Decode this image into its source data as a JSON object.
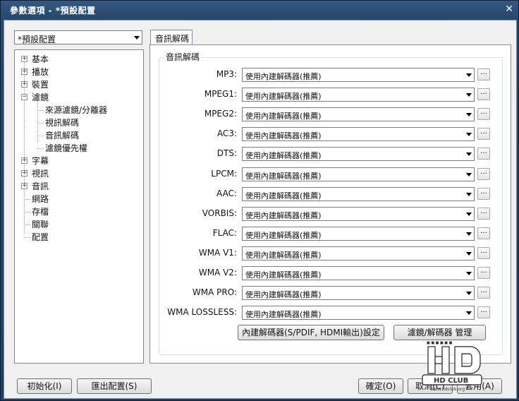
{
  "window": {
    "title": "參數選項 - *預設配置",
    "close_glyph": "✕"
  },
  "profile": {
    "selected": "*預設配置"
  },
  "tree": {
    "items": [
      {
        "label": "基本",
        "expander": "+",
        "level": 0
      },
      {
        "label": "播放",
        "expander": "+",
        "level": 0
      },
      {
        "label": "裝置",
        "expander": "+",
        "level": 0
      },
      {
        "label": "濾鏡",
        "expander": "−",
        "level": 0
      },
      {
        "label": "來源濾鏡/分離器",
        "level": 1
      },
      {
        "label": "視訊解碼",
        "level": 1
      },
      {
        "label": "音訊解碼",
        "level": 1
      },
      {
        "label": "濾鏡優先權",
        "level": 1
      },
      {
        "label": "字幕",
        "expander": "+",
        "level": 0
      },
      {
        "label": "視訊",
        "expander": "+",
        "level": 0
      },
      {
        "label": "音訊",
        "expander": "+",
        "level": 0
      },
      {
        "label": "網路",
        "level": 0
      },
      {
        "label": "存檔",
        "level": 0
      },
      {
        "label": "關聯",
        "level": 0
      },
      {
        "label": "配置",
        "level": 0
      }
    ]
  },
  "tab": {
    "label": "音訊解碼"
  },
  "group": {
    "label": "音訊解碼"
  },
  "decoders": [
    {
      "label": "MP3:",
      "value": "使用內建解碼器(推薦)"
    },
    {
      "label": "MPEG1:",
      "value": "使用內建解碼器(推薦)"
    },
    {
      "label": "MPEG2:",
      "value": "使用內建解碼器(推薦)"
    },
    {
      "label": "AC3:",
      "value": "使用內建解碼器(推薦)"
    },
    {
      "label": "DTS:",
      "value": "使用內建解碼器(推薦)"
    },
    {
      "label": "LPCM:",
      "value": "使用內建解碼器(推薦)"
    },
    {
      "label": "AAC:",
      "value": "使用內建解碼器(推薦)"
    },
    {
      "label": "VORBIS:",
      "value": "使用內建解碼器(推薦)"
    },
    {
      "label": "FLAC:",
      "value": "使用內建解碼器(推薦)"
    },
    {
      "label": "WMA V1:",
      "value": "使用內建解碼器(推薦)"
    },
    {
      "label": "WMA V2:",
      "value": "使用內建解碼器(推薦)"
    },
    {
      "label": "WMA PRO:",
      "value": "使用內建解碼器(推薦)"
    },
    {
      "label": "WMA LOSSLESS:",
      "value": "使用內建解碼器(推薦)"
    }
  ],
  "dots_label": "...",
  "panel_buttons": {
    "builtin_settings": "內建解碼器(S/PDIF, HDMI輸出)設定",
    "manage": "濾鏡/解碼器 管理"
  },
  "footer": {
    "reset": "初始化(I)",
    "export": "匯出配置(S)",
    "ok": "確定(O)",
    "cancel": "取消(C)",
    "apply": "套用(A)"
  },
  "watermark": {
    "text": "HD CLUB",
    "url": "www.hdclub.org"
  }
}
